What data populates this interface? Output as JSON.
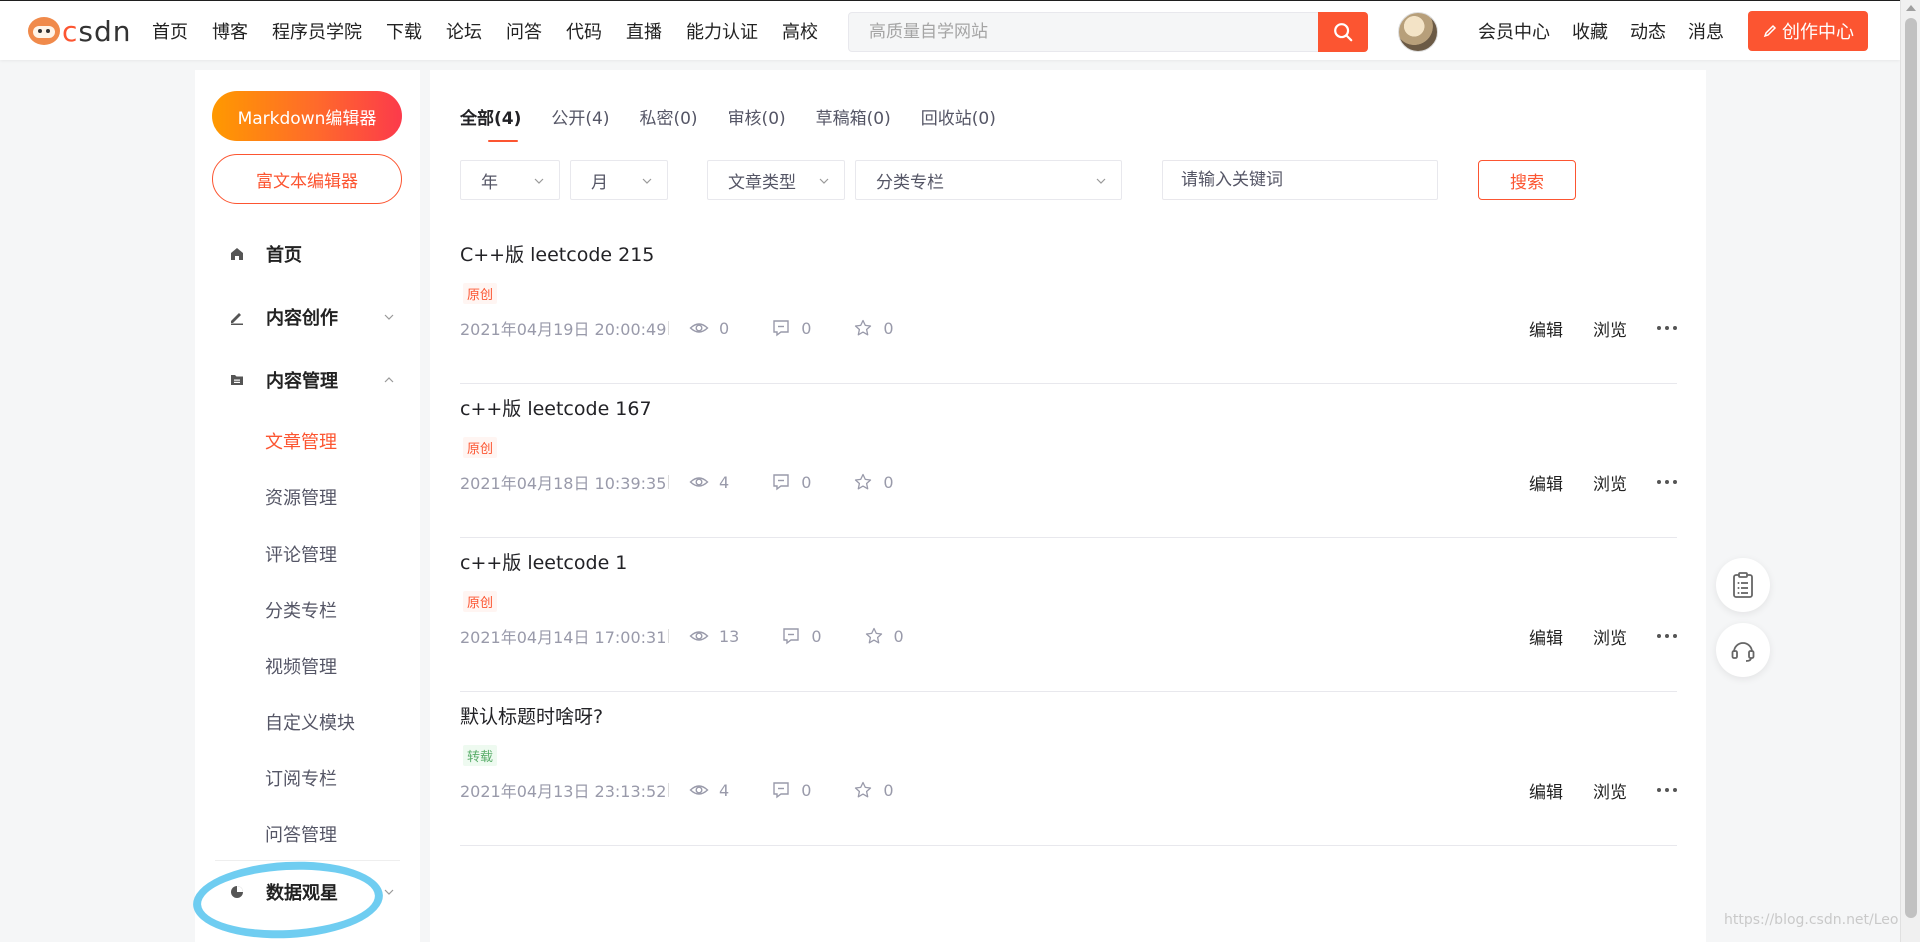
{
  "header": {
    "logo_text": "CSDN",
    "nav": [
      "首页",
      "博客",
      "程序员学院",
      "下载",
      "论坛",
      "问答",
      "代码",
      "直播",
      "能力认证",
      "高校"
    ],
    "search_placeholder": "高质量自学网站",
    "right_nav": [
      "会员中心",
      "收藏",
      "动态",
      "消息"
    ],
    "create_label": "创作中心"
  },
  "sidebar": {
    "markdown_btn": "Markdown编辑器",
    "richtext_btn": "富文本编辑器",
    "home": "首页",
    "content_create": "内容创作",
    "content_manage": "内容管理",
    "sub_items": [
      "文章管理",
      "资源管理",
      "评论管理",
      "分类专栏",
      "视频管理",
      "自定义模块",
      "订阅专栏",
      "问答管理"
    ],
    "active_sub": "文章管理",
    "data_observe": "数据观星"
  },
  "main": {
    "tabs": [
      "全部(4)",
      "公开(4)",
      "私密(0)",
      "审核(0)",
      "草稿箱(0)",
      "回收站(0)"
    ],
    "active_tab": 0,
    "filters": {
      "year": "年",
      "month": "月",
      "type": "文章类型",
      "category": "分类专栏",
      "keyword_placeholder": "请输入关键词",
      "search_btn": "搜索"
    },
    "articles": [
      {
        "title": "C++版 leetcode 215",
        "tag": "原创",
        "tag_type": "orig",
        "date": "2021年04月19日 20:00:49",
        "views": "0",
        "comments": "0",
        "likes": "0"
      },
      {
        "title": "c++版 leetcode 167",
        "tag": "原创",
        "tag_type": "orig",
        "date": "2021年04月18日 10:39:35",
        "views": "4",
        "comments": "0",
        "likes": "0"
      },
      {
        "title": "c++版 leetcode 1",
        "tag": "原创",
        "tag_type": "orig",
        "date": "2021年04月14日 17:00:31",
        "views": "13",
        "comments": "0",
        "likes": "0"
      },
      {
        "title": "默认标题时啥呀?",
        "tag": "转载",
        "tag_type": "repost",
        "date": "2021年04月13日 23:13:52",
        "views": "4",
        "comments": "0",
        "likes": "0"
      }
    ],
    "actions": {
      "edit": "编辑",
      "view": "浏览"
    }
  },
  "watermark": "https://blog.csdn.net/Leo",
  "colors": {
    "accent": "#fc5531",
    "highlight": "#5fc8ef"
  }
}
